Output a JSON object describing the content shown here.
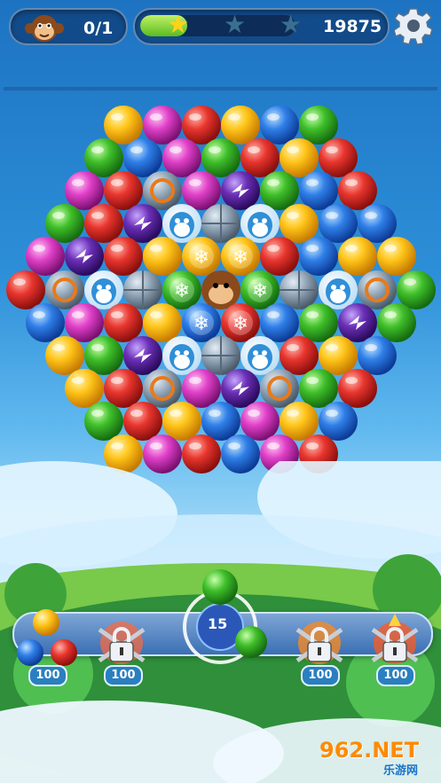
{
  "hud": {
    "moves": "0/1",
    "score": "19875",
    "progress_fraction": 0.3,
    "stars_earned": 1,
    "stars_total": 3
  },
  "shooter": {
    "remaining": "15"
  },
  "boosters": [
    {
      "name": "color-swap",
      "count": "100",
      "locked": false
    },
    {
      "name": "rainbow",
      "count": "100",
      "locked": true
    },
    {
      "name": "fire",
      "count": "100",
      "locked": true
    },
    {
      "name": "bomb",
      "count": "100",
      "locked": true
    }
  ],
  "watermark": {
    "text": "962.NET",
    "subtext": "乐游网"
  },
  "colors": {
    "red": "#e8352e",
    "green": "#3fbf2a",
    "blue": "#2f7fe8",
    "yellow": "#ffc51a",
    "pink": "#e040c8",
    "purple": "#6a2fb6"
  }
}
